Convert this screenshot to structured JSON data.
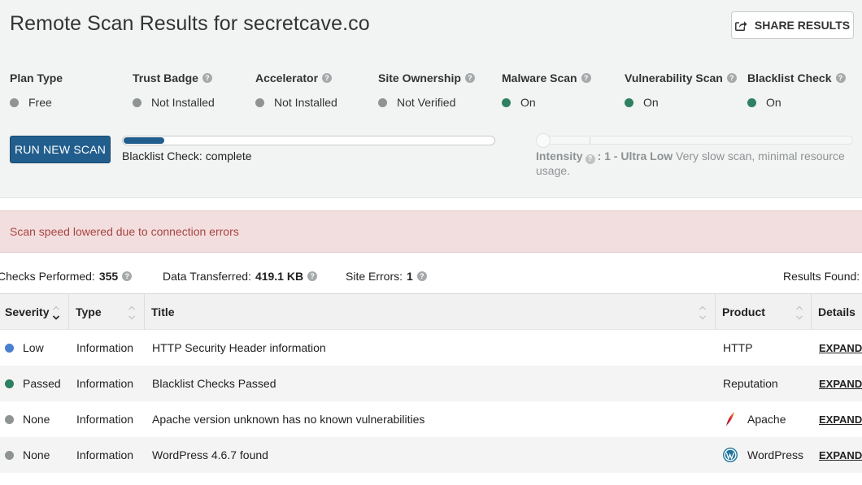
{
  "header": {
    "title": "Remote Scan Results for secretcave.co",
    "share_label": "SHARE RESULTS"
  },
  "stats": [
    {
      "label": "Plan Type",
      "value": "Free",
      "status_color": "#8f9393",
      "help": false
    },
    {
      "label": "Trust Badge",
      "value": "Not Installed",
      "status_color": "#8f9393",
      "help": true
    },
    {
      "label": "Accelerator",
      "value": "Not Installed",
      "status_color": "#8f9393",
      "help": true
    },
    {
      "label": "Site Ownership",
      "value": "Not Verified",
      "status_color": "#8f9393",
      "help": true
    },
    {
      "label": "Malware Scan",
      "value": "On",
      "status_color": "#2e8060",
      "help": true
    },
    {
      "label": "Vulnerability Scan",
      "value": "On",
      "status_color": "#2e8060",
      "help": true
    },
    {
      "label": "Blacklist Check",
      "value": "On",
      "status_color": "#2e8060",
      "help": true
    }
  ],
  "scan": {
    "run_label": "RUN NEW SCAN",
    "progress_fraction": 0.11,
    "progress_text": "Blacklist Check: complete"
  },
  "intensity": {
    "label": "Intensity",
    "level": ": 1 - Ultra Low",
    "description": "Very slow scan, minimal resource usage.",
    "slider_value": 1
  },
  "alert": {
    "text": "Scan speed lowered due to connection errors"
  },
  "summary": {
    "checks_label": "Checks Performed:",
    "checks_value": "355",
    "data_label": "Data Transferred:",
    "data_value": "419.1 KB",
    "errors_label": "Site Errors:",
    "errors_value": "1",
    "results_label": "Results Found:"
  },
  "table": {
    "headers": {
      "severity": "Severity",
      "type": "Type",
      "title": "Title",
      "product": "Product",
      "details": "Details"
    },
    "rows": [
      {
        "severity": "Low",
        "severity_color": "#4a7fd0",
        "type": "Information",
        "title": "HTTP Security Header information",
        "product": "HTTP",
        "product_icon": "",
        "details": "EXPAND"
      },
      {
        "severity": "Passed",
        "severity_color": "#2e8060",
        "type": "Information",
        "title": "Blacklist Checks Passed",
        "product": "Reputation",
        "product_icon": "",
        "details": "EXPAND"
      },
      {
        "severity": "None",
        "severity_color": "#8f9393",
        "type": "Information",
        "title": "Apache version unknown has no known vulnerabilities",
        "product": "Apache",
        "product_icon": "apache-feather-icon",
        "details": "EXPAND"
      },
      {
        "severity": "None",
        "severity_color": "#8f9393",
        "type": "Information",
        "title": "WordPress 4.6.7 found",
        "product": "WordPress",
        "product_icon": "wordpress-logo-icon",
        "details": "EXPAND"
      }
    ]
  }
}
